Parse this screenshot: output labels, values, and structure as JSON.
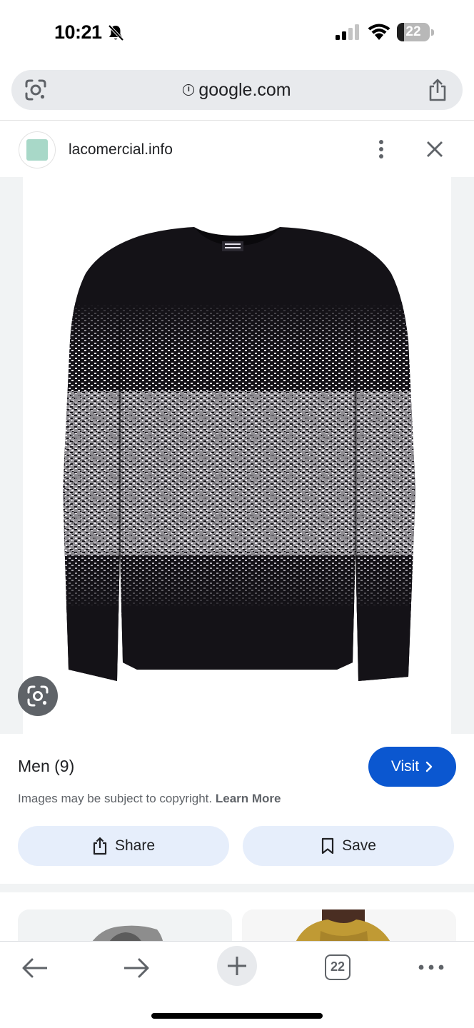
{
  "status_bar": {
    "time": "10:21",
    "battery_level": "22",
    "battery_fraction": 0.22,
    "icons": [
      "bell-slash-icon",
      "cellular-signal-icon",
      "wifi-icon",
      "battery-icon"
    ]
  },
  "browser": {
    "url": "google.com",
    "icons": [
      "lens-icon",
      "info-icon",
      "share-icon"
    ]
  },
  "site": {
    "name": "lacomercial.info",
    "icons": [
      "favicon",
      "more-vert-icon",
      "close-icon"
    ]
  },
  "result": {
    "title": "Men (9)",
    "visit_label": "Visit",
    "copyright_text": "Images may be subject to copyright.",
    "learn_more_label": "Learn More",
    "share_label": "Share",
    "save_label": "Save"
  },
  "toolbar": {
    "tab_count": "22",
    "icons": [
      "back-arrow-icon",
      "forward-arrow-icon",
      "new-tab-icon",
      "tab-switcher-icon",
      "more-horiz-icon"
    ]
  },
  "colors": {
    "accent": "#0b57d0",
    "button_tint": "#e6eefb",
    "url_bar": "#e8eaed",
    "favicon": "#a8d8c8",
    "sweater_dark": "#141217"
  }
}
